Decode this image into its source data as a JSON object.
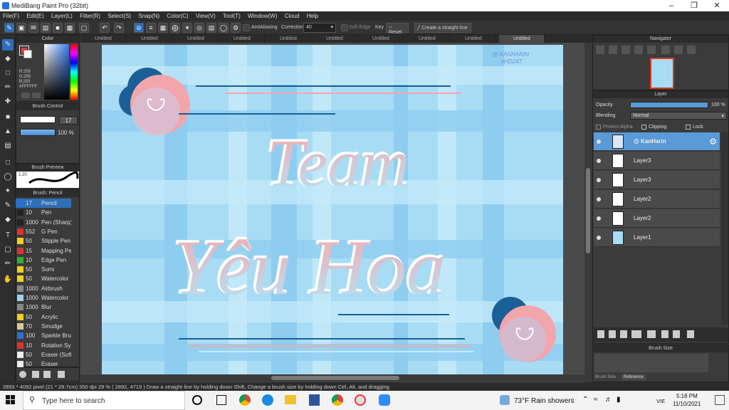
{
  "window": {
    "title": "MediBang Paint Pro (32bit)"
  },
  "menu": [
    "File(F)",
    "Edit(E)",
    "Layer(L)",
    "Filter(R)",
    "Select(S)",
    "Snap(N)",
    "Color(C)",
    "View(V)",
    "Tool(T)",
    "Window(W)",
    "Cloud",
    "Help"
  ],
  "toolbar": {
    "antialiasing_label": "AntiAliasing",
    "correction_label": "Correction",
    "correction_value": "40",
    "soft_edge_label": "Soft Edge",
    "key_label": "Key",
    "reset_label": "Reset",
    "straight_line_label": "Create a straight line"
  },
  "tabs": [
    "Untitled",
    "Untitled",
    "Untitled",
    "Untitled",
    "Untitled",
    "Untitled",
    "Untitled",
    "Untitled",
    "Untitled",
    "Untitled"
  ],
  "color_panel": {
    "title": "Color",
    "r": "R:255",
    "g": "G:255",
    "b": "B:255",
    "hex": "#FFFFFF",
    "fg": "#e23b3b",
    "bg": "#ffffff"
  },
  "brush_control": {
    "title": "Brush Control",
    "size": "17",
    "opacity": "100 %"
  },
  "brush_preview": {
    "title": "Brush Preview",
    "size_label": "1.20"
  },
  "brush_list": {
    "title": "Brush: Pencil",
    "items": [
      {
        "size": "17",
        "name": "Pencil",
        "color": "#2a6fd6"
      },
      {
        "size": "10",
        "name": "Pen",
        "color": "#222222"
      },
      {
        "size": "1000",
        "name": "Pen (Sharp)",
        "color": "#222222"
      },
      {
        "size": "552",
        "name": "G Pen",
        "color": "#e03030"
      },
      {
        "size": "50",
        "name": "Stipple Pen",
        "color": "#f0d020"
      },
      {
        "size": "15",
        "name": "Mapping Pen",
        "color": "#e03030"
      },
      {
        "size": "10",
        "name": "Edge Pen",
        "color": "#30b030"
      },
      {
        "size": "50",
        "name": "Sumi",
        "color": "#f0d020"
      },
      {
        "size": "50",
        "name": "Watercolor",
        "color": "#f0d020"
      },
      {
        "size": "1000",
        "name": "Airbrush",
        "color": "#888888"
      },
      {
        "size": "1000",
        "name": "Watercolor",
        "color": "#a0d0f0"
      },
      {
        "size": "1000",
        "name": "Blur",
        "color": "#888888"
      },
      {
        "size": "50",
        "name": "Acrylic",
        "color": "#f0d020"
      },
      {
        "size": "70",
        "name": "Smudge",
        "color": "#d8c8a0"
      },
      {
        "size": "100",
        "name": "Sparkle Brush",
        "color": "#2a6fd6"
      },
      {
        "size": "10",
        "name": "Rotation Symmetry",
        "color": "#e03030"
      },
      {
        "size": "50",
        "name": "Eraser (Soft)",
        "color": "#eeeeee"
      },
      {
        "size": "50",
        "name": "Eraser",
        "color": "#eeeeee"
      }
    ]
  },
  "canvas": {
    "watermark_line1": "@ KANHARIN",
    "watermark_line2": "#HD247",
    "text_line1": "Team",
    "text_line2": "Yêu Hoa",
    "bg_color": "#a8dcf5",
    "pink": "#f2a6ac",
    "navy": "#1a5f96"
  },
  "navigator": {
    "title": "Navigator"
  },
  "layer_panel": {
    "title": "Layer",
    "opacity_label": "Opacity",
    "opacity_value": "100 %",
    "blending_label": "Blending",
    "blending_value": "Normal",
    "protect_alpha": "Protect Alpha",
    "clipping": "Clipping",
    "lock": "Lock",
    "layers": [
      {
        "name": "@ KanHarin",
        "selected": true
      },
      {
        "name": "Layer3",
        "selected": false
      },
      {
        "name": "Layer3",
        "selected": false
      },
      {
        "name": "Layer2",
        "selected": false
      },
      {
        "name": "Layer2",
        "selected": false
      },
      {
        "name": "Layer1",
        "selected": false
      }
    ]
  },
  "brush_size_panel": {
    "title": "Brush Size",
    "tab1": "Brush Size",
    "tab2": "Reference"
  },
  "status": {
    "text": "2893 * 4092 pixel  (21 * 29.7cm)  350 dpi  29 %  ( 2892, 4719 )  Draw a straight line by holding down Shift, Change a brush size by holding down Ctrl, Alt, and dragging"
  },
  "taskbar": {
    "search_placeholder": "Type here to search",
    "weather": "73°F  Rain showers",
    "lang": "VIE",
    "time": "5:18 PM",
    "date": "11/10/2021"
  }
}
